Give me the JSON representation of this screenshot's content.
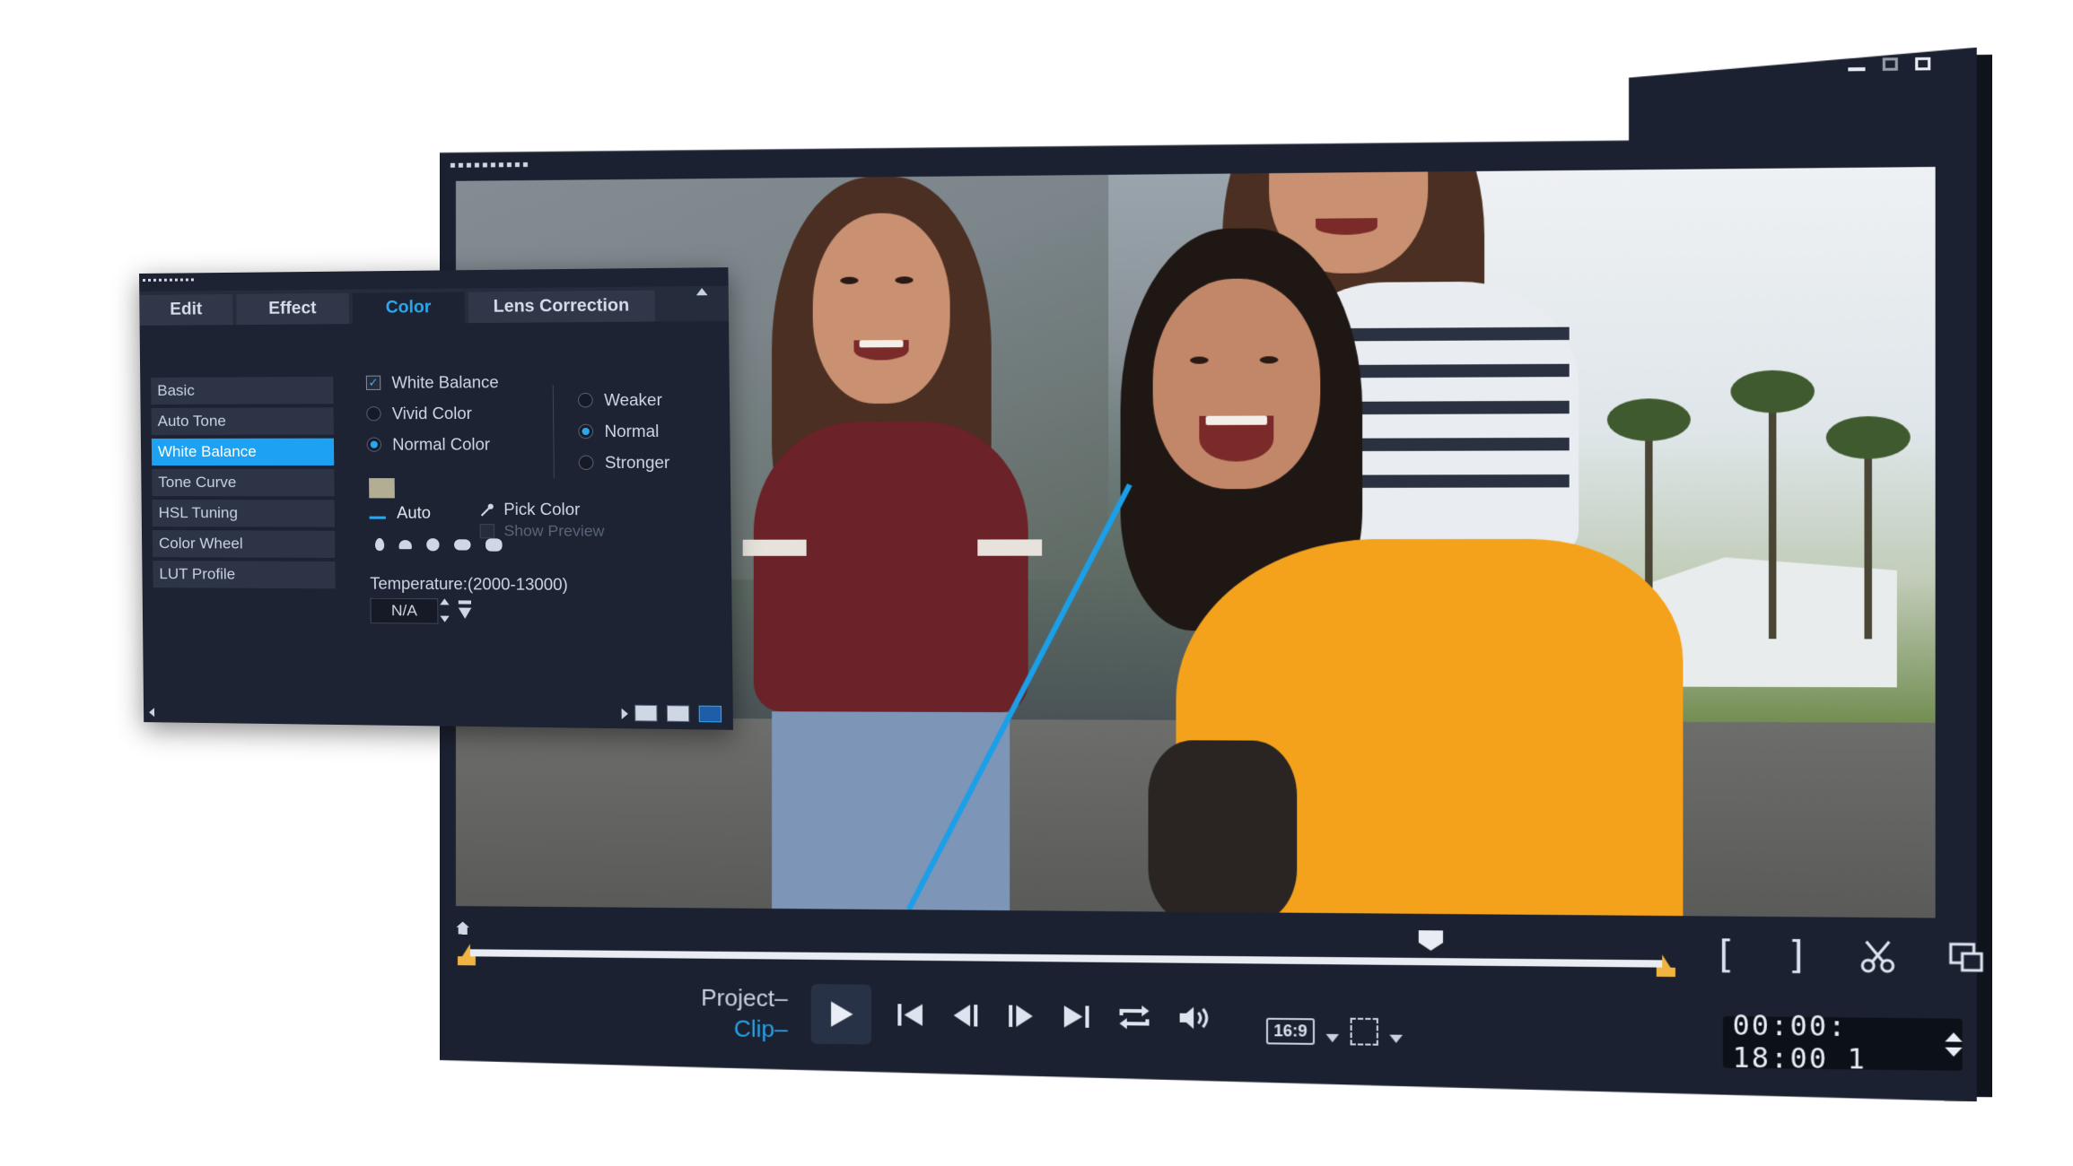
{
  "panel": {
    "tabs": [
      {
        "label": "Edit"
      },
      {
        "label": "Effect"
      },
      {
        "label": "Color"
      },
      {
        "label": "Lens Correction"
      }
    ],
    "menu": [
      {
        "label": "Basic"
      },
      {
        "label": "Auto Tone"
      },
      {
        "label": "White Balance"
      },
      {
        "label": "Tone Curve"
      },
      {
        "label": "HSL Tuning"
      },
      {
        "label": "Color Wheel"
      },
      {
        "label": "LUT Profile"
      }
    ],
    "white_balance_label": "White Balance",
    "vivid_color": "Vivid Color",
    "normal_color": "Normal Color",
    "weaker": "Weaker",
    "normal": "Normal",
    "stronger": "Stronger",
    "auto": "Auto",
    "pick_color": "Pick Color",
    "show_preview": "Show Preview",
    "temperature_label": "Temperature:(2000-13000)",
    "temperature_value": "N/A",
    "checkmark": "✓",
    "swatch_color": "#b3ad93",
    "accent": "#1da1f2"
  },
  "player": {
    "project_label": "Project–",
    "clip_label": "Clip–",
    "aspect_ratio": "16:9",
    "timecode": "00:00: 18:00 1",
    "bracket_in": "[",
    "bracket_out": "]"
  },
  "icons": {
    "play": "play-icon",
    "prev": "skip-to-start-icon",
    "step_back": "step-back-icon",
    "step_fwd": "step-forward-icon",
    "next": "skip-to-end-icon",
    "repeat": "repeat-icon",
    "volume": "volume-icon",
    "cut": "scissors-icon",
    "output": "output-window-icon"
  }
}
